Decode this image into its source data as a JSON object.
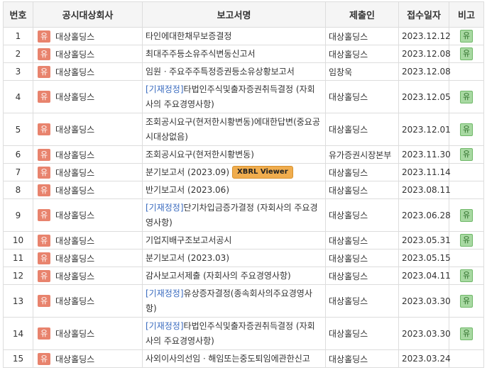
{
  "headers": {
    "no": "번호",
    "company": "공시대상회사",
    "report": "보고서명",
    "submitter": "제출인",
    "date": "접수일자",
    "note": "비고"
  },
  "corp_badge": "유",
  "note_badge": "유",
  "amend_tag": "[기재정정]",
  "xbrl_label": "XBRL Viewer",
  "colors": {
    "corp_badge": "#e8836d",
    "note_badge": "#a8d9a2",
    "amend_link": "#3a6bbf",
    "xbrl": "#f0ad4e"
  },
  "rows": [
    {
      "no": "1",
      "company": "대상홀딩스",
      "report": "타인에대한채무보증결정",
      "submitter": "대상홀딩스",
      "date": "2023.12.12",
      "note": "유"
    },
    {
      "no": "2",
      "company": "대상홀딩스",
      "report": "최대주주등소유주식변동신고서",
      "submitter": "대상홀딩스",
      "date": "2023.12.08",
      "note": "유"
    },
    {
      "no": "3",
      "company": "대상홀딩스",
      "report": "임원ㆍ주요주주특정증권등소유상황보고서",
      "submitter": "임창욱",
      "date": "2023.12.08",
      "note": ""
    },
    {
      "no": "4",
      "company": "대상홀딩스",
      "report": "타법인주식및출자증권취득결정 (자회사의 주요경영사항)",
      "amend": true,
      "submitter": "대상홀딩스",
      "date": "2023.12.05",
      "note": "유"
    },
    {
      "no": "5",
      "company": "대상홀딩스",
      "report": "조회공시요구(현저한시황변동)에대한답변(중요공시대상없음)",
      "submitter": "대상홀딩스",
      "date": "2023.12.01",
      "note": "유"
    },
    {
      "no": "6",
      "company": "대상홀딩스",
      "report": "조회공시요구(현저한시황변동)",
      "submitter": "유가증권시장본부",
      "date": "2023.11.30",
      "note": "유"
    },
    {
      "no": "7",
      "company": "대상홀딩스",
      "report": "분기보고서 (2023.09)",
      "xbrl": true,
      "submitter": "대상홀딩스",
      "date": "2023.11.14",
      "note": ""
    },
    {
      "no": "8",
      "company": "대상홀딩스",
      "report": "반기보고서 (2023.06)",
      "submitter": "대상홀딩스",
      "date": "2023.08.11",
      "note": ""
    },
    {
      "no": "9",
      "company": "대상홀딩스",
      "report": "단기차입금증가결정 (자회사의 주요경영사항)",
      "amend": true,
      "submitter": "대상홀딩스",
      "date": "2023.06.28",
      "note": "유"
    },
    {
      "no": "10",
      "company": "대상홀딩스",
      "report": "기업지배구조보고서공시",
      "submitter": "대상홀딩스",
      "date": "2023.05.31",
      "note": "유"
    },
    {
      "no": "11",
      "company": "대상홀딩스",
      "report": "분기보고서 (2023.03)",
      "submitter": "대상홀딩스",
      "date": "2023.05.15",
      "note": ""
    },
    {
      "no": "12",
      "company": "대상홀딩스",
      "report": "감사보고서제출 (자회사의 주요경영사항)",
      "submitter": "대상홀딩스",
      "date": "2023.04.11",
      "note": "유"
    },
    {
      "no": "13",
      "company": "대상홀딩스",
      "report": "유상증자결정(종속회사의주요경영사항)",
      "amend": true,
      "submitter": "대상홀딩스",
      "date": "2023.03.30",
      "note": "유"
    },
    {
      "no": "14",
      "company": "대상홀딩스",
      "report": "타법인주식및출자증권취득결정 (자회사의 주요경영사항)",
      "amend": true,
      "submitter": "대상홀딩스",
      "date": "2023.03.30",
      "note": "유"
    },
    {
      "no": "15",
      "company": "대상홀딩스",
      "report": "사외이사의선임ㆍ해임또는중도퇴임에관한신고",
      "submitter": "대상홀딩스",
      "date": "2023.03.24",
      "note": ""
    }
  ]
}
